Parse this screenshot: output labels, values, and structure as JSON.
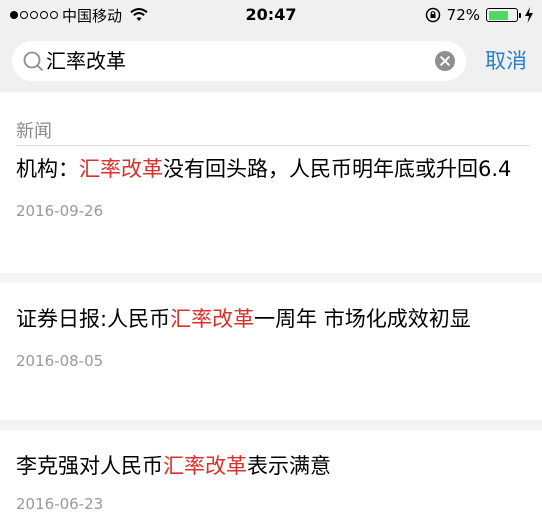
{
  "status_bar": {
    "carrier": "中国移动",
    "time": "20:47",
    "battery": "72%",
    "battery_level": 0.72
  },
  "search": {
    "query": "汇率改革",
    "cancel_label": "取消"
  },
  "section": {
    "label": "新闻"
  },
  "news": [
    {
      "pre": "机构：",
      "highlight": "汇率改革",
      "post": "没有回头路，人民币明年底或升回6.4",
      "date": "2016-09-26"
    },
    {
      "pre": "证券日报:人民币",
      "highlight": "汇率改革",
      "post": "一周年 市场化成效初显",
      "date": "2016-08-05"
    },
    {
      "pre": "李克强对人民币",
      "highlight": "汇率改革",
      "post": "表示满意",
      "date": "2016-06-23"
    }
  ],
  "colors": {
    "highlight": "#d9302a",
    "accent": "#2b7ec9"
  }
}
